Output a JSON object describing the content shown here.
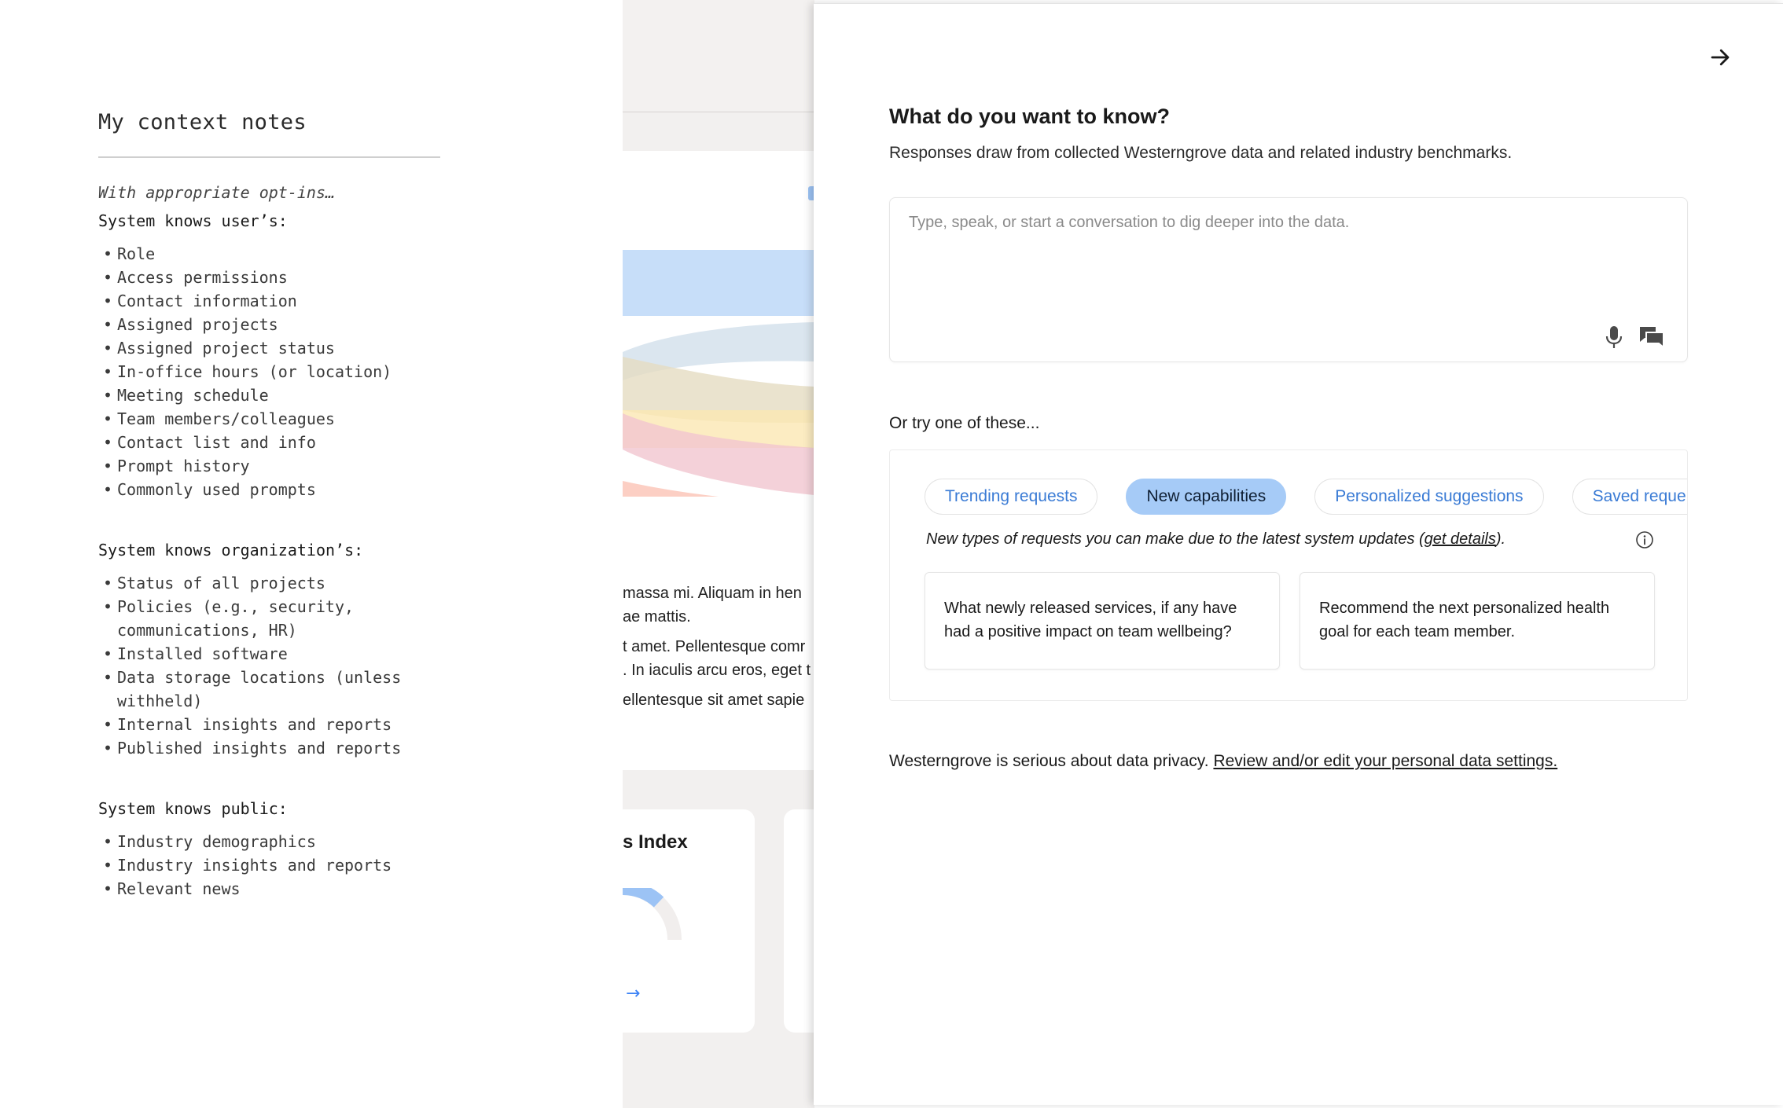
{
  "notes": {
    "title": "My context notes",
    "intro": "With appropriate opt-ins…",
    "sections": [
      {
        "heading": "System knows user’s:",
        "items": [
          "Role",
          "Access permissions",
          "Contact information",
          "Assigned projects",
          "Assigned project status",
          "In-office hours (or location)",
          "Meeting schedule",
          "Team members/colleagues",
          "Contact list and info",
          "Prompt history",
          "Commonly used prompts"
        ]
      },
      {
        "heading": "System knows organization’s:",
        "items": [
          "Status of all projects",
          "Policies (e.g., security, communications, HR)",
          "Installed software",
          "Data storage locations (unless withheld)",
          "Internal insights and reports",
          "Published insights and reports"
        ]
      },
      {
        "heading": "System knows public:",
        "items": [
          "Industry demographics",
          "Industry insights and reports",
          "Relevant news"
        ]
      }
    ]
  },
  "background": {
    "text_lines": [
      "massa mi. Aliquam in hen",
      "ae mattis.",
      "t amet. Pellentesque comr",
      ". In iaculis arcu eros, eget t",
      "ellentesque sit amet sapie"
    ],
    "card_title": "s Index",
    "arrow": "→",
    "colors": {
      "band_blue": "#b9d6f8",
      "band_grey": "#cfdde9",
      "band_tan": "#e5dcc2",
      "band_yellow": "#fbe7b3",
      "band_pink": "#f1c5cf",
      "band_salmon": "#fbc3b5",
      "gauge_blue": "#9cc3f5"
    }
  },
  "panel": {
    "close_icon": "arrow-right-icon",
    "title": "What do you want to know?",
    "subtitle": "Responses draw from collected Westerngrove data and related industry benchmarks.",
    "query": {
      "value": "",
      "placeholder": "Type, speak, or start a conversation to dig deeper into the data.",
      "mic_icon": "microphone-icon",
      "chat_icon": "chat-bubbles-icon"
    },
    "try_label": "Or try one of these...",
    "chips": [
      {
        "label": "Trending requests",
        "active": false
      },
      {
        "label": "New capabilities",
        "active": true
      },
      {
        "label": "Personalized suggestions",
        "active": false
      },
      {
        "label": "Saved reque",
        "active": false
      }
    ],
    "chip_description": {
      "text": "New types of requests you can make due to the latest system updates (",
      "link": "get details",
      "suffix": ")."
    },
    "info_icon": "info-circle-icon",
    "prompts": [
      "What newly released services, if any have had a positive impact on team wellbeing?",
      "Recommend the next personalized health goal for each team member."
    ],
    "privacy": {
      "text": "Westerngrove is serious about data privacy. ",
      "link": "Review and/or edit your personal data settings."
    },
    "colors": {
      "accent": "#3a7bd5",
      "chip_active_bg": "#a6cbf7"
    }
  }
}
